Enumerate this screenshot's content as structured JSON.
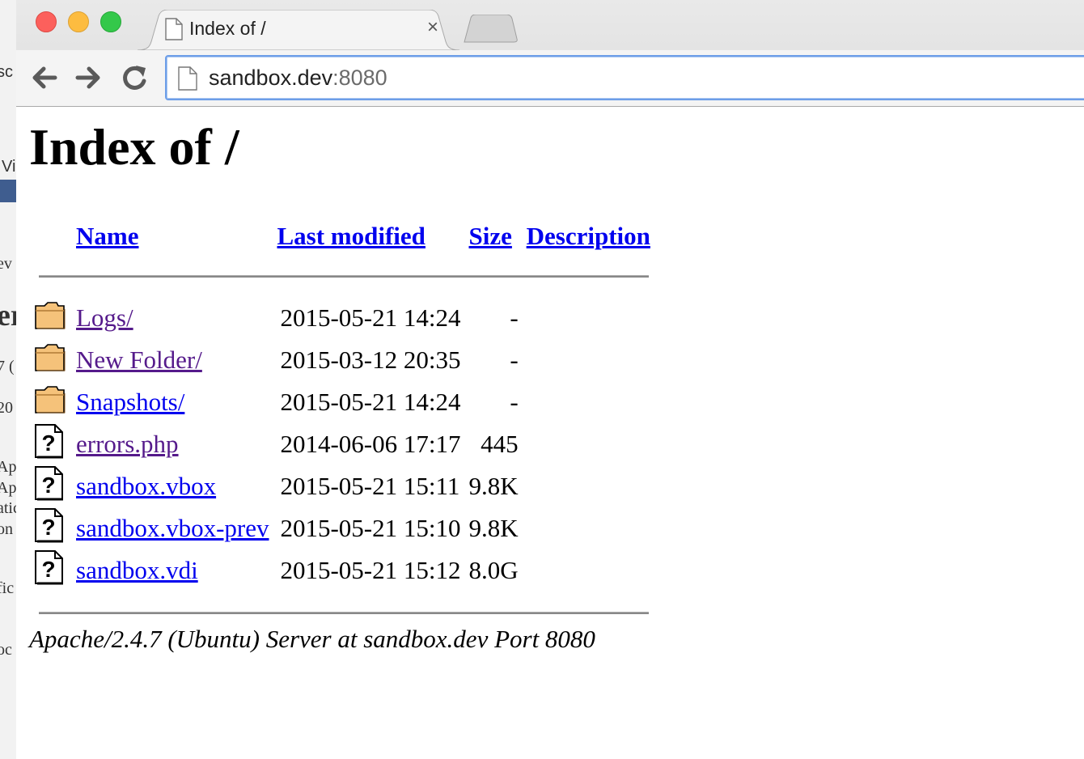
{
  "background_window": {
    "fragments": [
      "sc",
      "Vi",
      "ev",
      "er",
      "7 (",
      "20",
      "Ap",
      "Ap",
      "atic",
      "on",
      "fic",
      "oc"
    ]
  },
  "browser": {
    "tab": {
      "title": "Index of /",
      "close_glyph": "×"
    },
    "omnibox": {
      "host": "sandbox.dev",
      "port": ":8080"
    }
  },
  "page": {
    "title": "Index of /",
    "columns": {
      "name": "Name",
      "last_modified": "Last modified",
      "size": "Size",
      "description": "Description"
    },
    "rows": [
      {
        "icon": "folder-icon",
        "name": "Logs/",
        "modified": "2015-05-21 14:24",
        "size": "-",
        "description": "",
        "visited": true
      },
      {
        "icon": "folder-icon",
        "name": "New Folder/",
        "modified": "2015-03-12 20:35",
        "size": "-",
        "description": "",
        "visited": true
      },
      {
        "icon": "folder-icon",
        "name": "Snapshots/",
        "modified": "2015-05-21 14:24",
        "size": "-",
        "description": "",
        "visited": false
      },
      {
        "icon": "unknown-file-icon",
        "name": "errors.php",
        "modified": "2014-06-06 17:17",
        "size": "445",
        "description": "",
        "visited": true
      },
      {
        "icon": "unknown-file-icon",
        "name": "sandbox.vbox",
        "modified": "2015-05-21 15:11",
        "size": "9.8K",
        "description": "",
        "visited": false
      },
      {
        "icon": "unknown-file-icon",
        "name": "sandbox.vbox-prev",
        "modified": "2015-05-21 15:10",
        "size": "9.8K",
        "description": "",
        "visited": false
      },
      {
        "icon": "unknown-file-icon",
        "name": "sandbox.vdi",
        "modified": "2015-05-21 15:12",
        "size": "8.0G",
        "description": "",
        "visited": false
      }
    ],
    "server_signature": "Apache/2.4.7 (Ubuntu) Server at sandbox.dev Port 8080"
  },
  "colors": {
    "link": "#0000ee",
    "visited_link": "#551a8b",
    "omnibox_focus": "#6d9ee8",
    "folder_fill": "#f5c27a"
  }
}
